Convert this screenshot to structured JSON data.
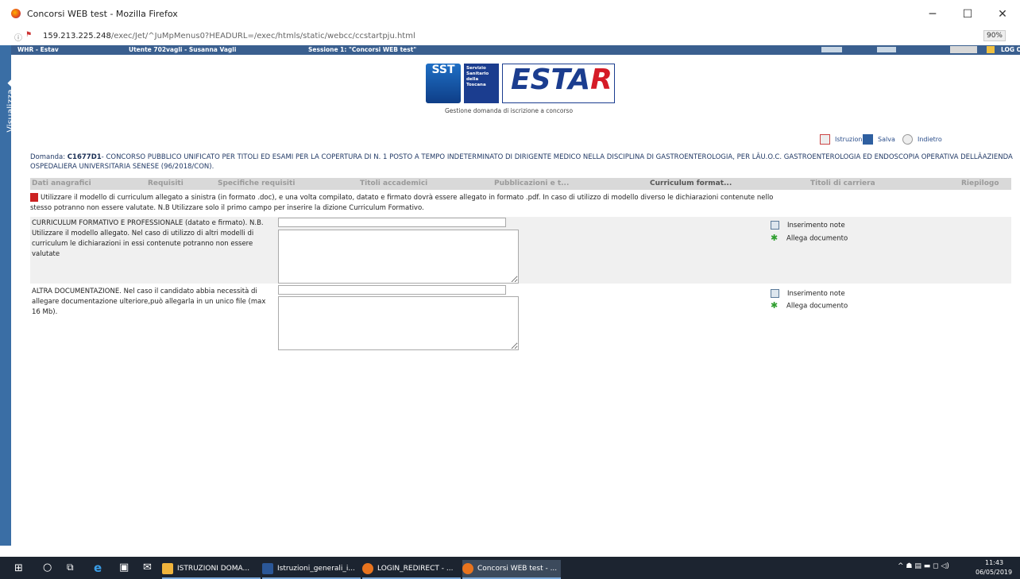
{
  "browser": {
    "window_title": "Concorsi WEB test - Mozilla Firefox",
    "url_prefix": "159.213.225.248",
    "url_rest": "/exec/Jet/^JuMpMenus0?HEADURL=/exec/htmls/static/webcc/ccstartpju.html",
    "zoom": "90%",
    "minimize": "─",
    "maximize": "☐",
    "close": "✕"
  },
  "appbar": {
    "app": "WHR - Estav",
    "user": "Utente 702vagli - Susanna Vagli",
    "session": "Sessione 1: \"Concorsi WEB test\"",
    "logout": "LOG OUT"
  },
  "sidebar": {
    "tab_label": "Visualizza ◆"
  },
  "logo": {
    "sst": "SST",
    "servizio": "Servizio Sanitario della Toscana",
    "estar_main": "ESTA",
    "estar_r": "R",
    "caption": "Gestione domanda di iscrizione a concorso"
  },
  "actions": {
    "istruzioni": "Istruzioni",
    "salva": "Salva",
    "indietro": "Indietro"
  },
  "domanda": {
    "prefix": "Domanda: ",
    "code": "C1677D1",
    "text": "- CONCORSO PUBBLICO UNIFICATO PER TITOLI ED ESAMI PER LA COPERTURA DI N. 1 POSTO A TEMPO INDETERMINATO DI DIRIGENTE MEDICO NELLA DISCIPLINA DI GASTROENTEROLOGIA, PER LÂU.O.C. GASTROENTEROLOGIA ED ENDOSCOPIA OPERATIVA DELLÂAZIENDA OSPEDALIERA UNIVERSITARIA SENESE (96/2018/CON)."
  },
  "tabs": [
    {
      "label": "Dati anagrafici"
    },
    {
      "label": "Requisiti"
    },
    {
      "label": "Specifiche requisiti"
    },
    {
      "label": "Titoli accademici"
    },
    {
      "label": "Pubblicazioni e t..."
    },
    {
      "label": "Curriculum format..."
    },
    {
      "label": "Titoli di carriera"
    },
    {
      "label": "Riepilogo"
    }
  ],
  "active_tab": "Curriculum format...",
  "info": "Utilizzare il modello di curriculum allegato a sinistra (in formato .doc), e una volta compilato, datato e firmato dovrà essere allegato in formato .pdf. In caso di utilizzo di modello diverso le dichiarazioni contenute nello stesso potranno non essere valutate. N.B Utilizzare solo il primo campo per inserire la dizione Curriculum Formativo.",
  "sections": [
    {
      "label": "CURRICULUM FORMATIVO E PROFESSIONALE (datato e firmato). N.B. Utilizzare il modello allegato. Nel caso di utilizzo di altri modelli di curriculum le dichiarazioni in essi contenute potranno non essere valutate",
      "input_value": "",
      "notes_label": "Inserimento note",
      "attach_label": "Allega documento"
    },
    {
      "label": "ALTRA DOCUMENTAZIONE. Nel caso il candidato abbia necessità di allegare documentazione ulteriore,può allegarla in un unico file (max 16 Mb).",
      "input_value": "",
      "notes_label": "Inserimento note",
      "attach_label": "Allega documento"
    }
  ],
  "taskbar": {
    "items": [
      {
        "label": "ISTRUZIONI DOMA..."
      },
      {
        "label": "Istruzioni_generali_i..."
      },
      {
        "label": "LOGIN_REDIRECT - ..."
      },
      {
        "label": "Concorsi WEB test - ..."
      }
    ],
    "time": "11:43",
    "date": "06/05/2019"
  }
}
